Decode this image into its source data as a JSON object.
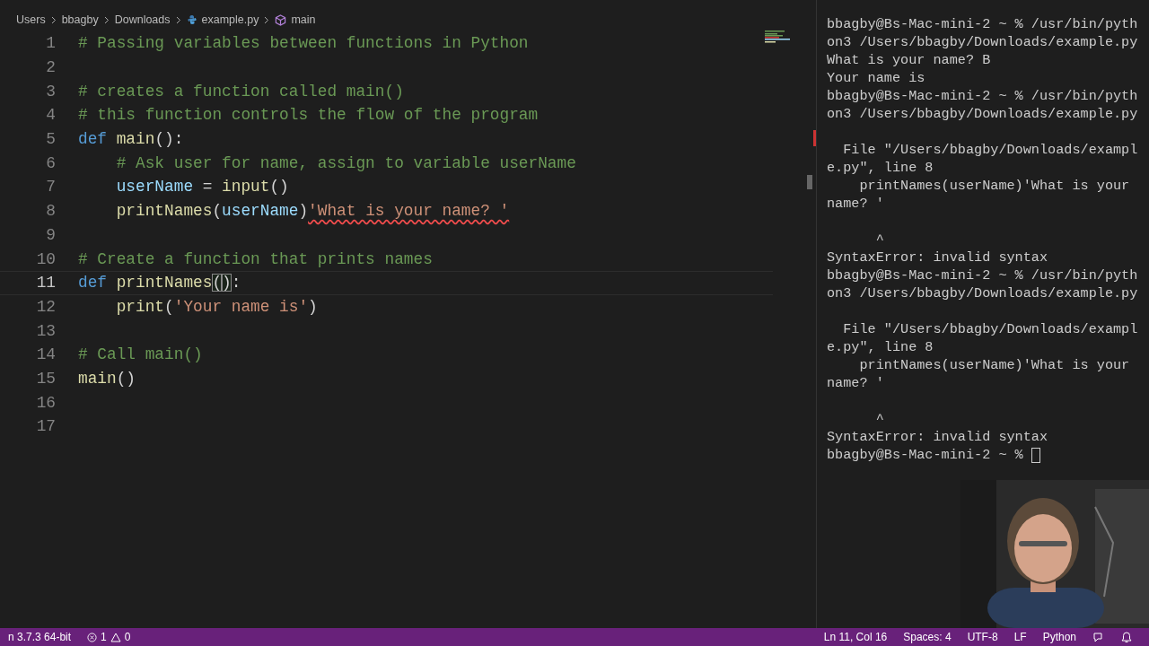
{
  "breadcrumbs": [
    {
      "label": "Users",
      "kind": "folder"
    },
    {
      "label": "bbagby",
      "kind": "folder"
    },
    {
      "label": "Downloads",
      "kind": "folder"
    },
    {
      "label": "example.py",
      "kind": "file"
    },
    {
      "label": "main",
      "kind": "symbol"
    }
  ],
  "editor": {
    "lines": [
      {
        "number": "1",
        "current": false,
        "tokens": [
          {
            "kind": "comment",
            "text": "# Passing variables between functions in Python"
          }
        ]
      },
      {
        "number": "2",
        "current": false
      },
      {
        "number": "3",
        "current": false,
        "tokens": [
          {
            "kind": "comment",
            "text": "# creates a function called main()"
          }
        ]
      },
      {
        "number": "4",
        "current": false,
        "tokens": [
          {
            "kind": "comment",
            "text": "# this function controls the flow of the program"
          }
        ]
      },
      {
        "number": "5",
        "current": false,
        "tokens": [
          {
            "kind": "keyword",
            "text": "def"
          },
          {
            "kind": "function",
            "text": " main"
          },
          {
            "kind": "plain",
            "text": "():"
          }
        ]
      },
      {
        "number": "6",
        "current": false,
        "tokens": [
          {
            "kind": "comment",
            "text": "    # Ask user for name, assign to variable userName"
          }
        ]
      },
      {
        "number": "7",
        "current": false,
        "tokens": [
          {
            "kind": "variable",
            "text": "    userName"
          },
          {
            "kind": "plain",
            "text": " = "
          },
          {
            "kind": "function",
            "text": "input"
          },
          {
            "kind": "plain",
            "text": "()"
          }
        ]
      },
      {
        "number": "8",
        "current": false,
        "tokens": [
          {
            "kind": "function",
            "text": "    printNames"
          },
          {
            "kind": "plain",
            "text": "("
          },
          {
            "kind": "variable",
            "text": "userName"
          },
          {
            "kind": "plain",
            "text": ")"
          },
          {
            "kind": "error",
            "text": "'What is your name? '"
          }
        ]
      },
      {
        "number": "9",
        "current": false
      },
      {
        "number": "10",
        "current": false,
        "tokens": [
          {
            "kind": "comment",
            "text": "# Create a function that prints names"
          }
        ]
      },
      {
        "number": "11",
        "current": true,
        "tokens": [
          {
            "kind": "keyword",
            "text": "def"
          },
          {
            "kind": "function",
            "text": " printNames"
          },
          {
            "kind": "bracket",
            "text": "("
          },
          {
            "kind": "bracket",
            "text": ")"
          },
          {
            "kind": "plain",
            "text": ":"
          }
        ]
      },
      {
        "number": "12",
        "current": false,
        "tokens": [
          {
            "kind": "function",
            "text": "    print"
          },
          {
            "kind": "plain",
            "text": "("
          },
          {
            "kind": "string",
            "text": "'Your name is'"
          },
          {
            "kind": "plain",
            "text": ")"
          }
        ]
      },
      {
        "number": "13",
        "current": false
      },
      {
        "number": "14",
        "current": false,
        "tokens": [
          {
            "kind": "comment",
            "text": "# Call main()"
          }
        ]
      },
      {
        "number": "15",
        "current": false,
        "tokens": [
          {
            "kind": "function",
            "text": "main"
          },
          {
            "kind": "plain",
            "text": "()"
          }
        ]
      },
      {
        "number": "16",
        "current": false
      },
      {
        "number": "17",
        "current": false
      }
    ]
  },
  "terminal": {
    "lines": [
      {
        "kind": "text",
        "text": "bbagby@Bs-Mac-mini-2 ~ % /usr/bin/pyth"
      },
      {
        "kind": "text",
        "text": "on3 /Users/bbagby/Downloads/example.py"
      },
      {
        "kind": "text",
        "text": "What is your name? B"
      },
      {
        "kind": "text",
        "text": "Your name is"
      },
      {
        "kind": "text",
        "text": "bbagby@Bs-Mac-mini-2 ~ % /usr/bin/pyth"
      },
      {
        "kind": "text",
        "text": "on3 /Users/bbagby/Downloads/example.py"
      },
      {
        "kind": "blank"
      },
      {
        "kind": "text",
        "text": "  File \"/Users/bbagby/Downloads/exampl"
      },
      {
        "kind": "text",
        "text": "e.py\", line 8"
      },
      {
        "kind": "text",
        "text": "    printNames(userName)'What is your"
      },
      {
        "kind": "text",
        "text": "name? '"
      },
      {
        "kind": "blank"
      },
      {
        "kind": "text",
        "text": "      ^"
      },
      {
        "kind": "text",
        "text": "SyntaxError: invalid syntax"
      },
      {
        "kind": "text",
        "text": "bbagby@Bs-Mac-mini-2 ~ % /usr/bin/pyth"
      },
      {
        "kind": "text",
        "text": "on3 /Users/bbagby/Downloads/example.py"
      },
      {
        "kind": "blank"
      },
      {
        "kind": "text",
        "text": "  File \"/Users/bbagby/Downloads/exampl"
      },
      {
        "kind": "text",
        "text": "e.py\", line 8"
      },
      {
        "kind": "text",
        "text": "    printNames(userName)'What is your"
      },
      {
        "kind": "text",
        "text": "name? '"
      },
      {
        "kind": "blank"
      },
      {
        "kind": "text",
        "text": "      ^"
      },
      {
        "kind": "text",
        "text": "SyntaxError: invalid syntax"
      },
      {
        "kind": "prompt",
        "text": "bbagby@Bs-Mac-mini-2 ~ % "
      }
    ]
  },
  "status_bar": {
    "interpreter": "n 3.7.3 64-bit",
    "errors": "1",
    "warnings": "0",
    "right": [
      {
        "label": "Ln 11, Col 16"
      },
      {
        "label": "Spaces: 4"
      },
      {
        "label": "UTF-8"
      },
      {
        "label": "LF"
      },
      {
        "label": "Python"
      }
    ]
  }
}
